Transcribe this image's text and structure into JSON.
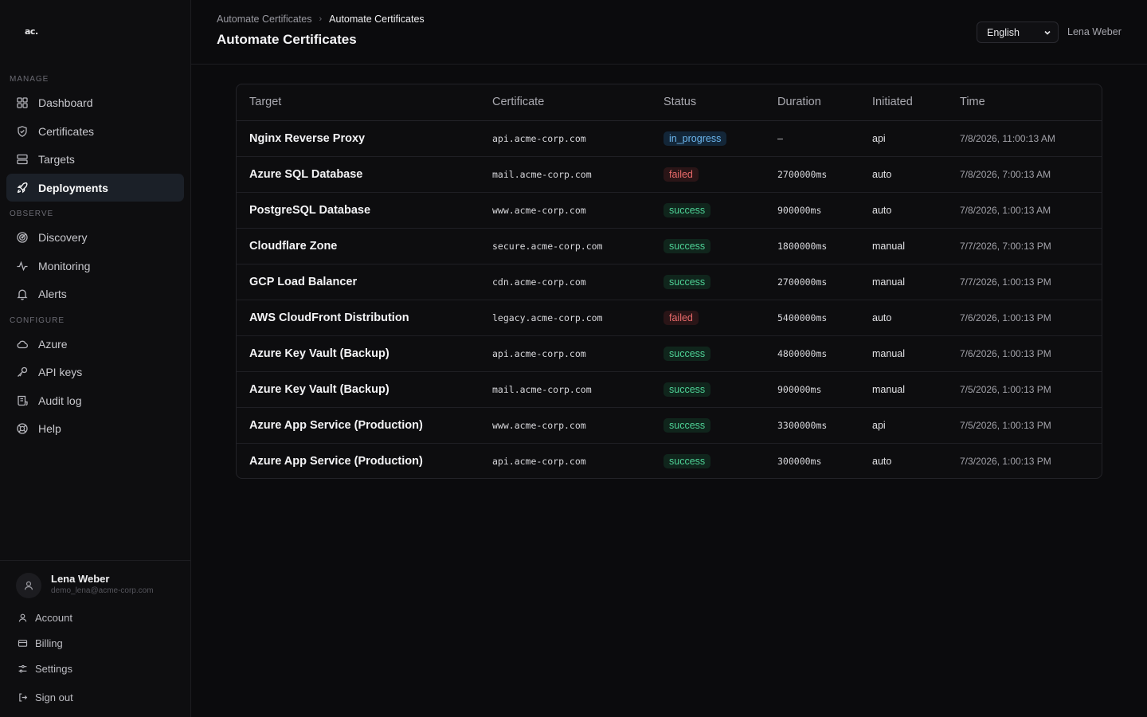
{
  "app": {
    "logo": "ac."
  },
  "sidebar": {
    "sections": {
      "manage": "MANAGE",
      "observe": "OBSERVE",
      "configure": "CONFIGURE"
    },
    "items": [
      {
        "label": "Dashboard",
        "icon": "grid-icon"
      },
      {
        "label": "Certificates",
        "icon": "shield-check-icon"
      },
      {
        "label": "Targets",
        "icon": "server-icon"
      },
      {
        "label": "Deployments",
        "icon": "rocket-icon",
        "active": true
      },
      {
        "label": "Discovery",
        "icon": "radar-icon"
      },
      {
        "label": "Monitoring",
        "icon": "activity-icon"
      },
      {
        "label": "Alerts",
        "icon": "bell-icon"
      },
      {
        "label": "Azure",
        "icon": "cloud-icon"
      },
      {
        "label": "API keys",
        "icon": "key-icon"
      },
      {
        "label": "Audit log",
        "icon": "scroll-icon"
      },
      {
        "label": "Help",
        "icon": "lifebuoy-icon"
      }
    ],
    "user": {
      "name": "Lena Weber",
      "email": "demo_lena@acme-corp.com",
      "links": {
        "account": "Account",
        "billing": "Billing",
        "settings": "Settings",
        "signout": "Sign out"
      }
    }
  },
  "header": {
    "breadcrumb": {
      "parent": "Automate Certificates",
      "current": "Automate Certificates"
    },
    "title": "Automate Certificates",
    "language": "English",
    "user_name": "Lena Weber"
  },
  "table": {
    "columns": [
      "Target",
      "Certificate",
      "Status",
      "Duration",
      "Initiated",
      "Time"
    ],
    "rows": [
      {
        "target": "Nginx Reverse Proxy",
        "certificate": "api.acme-corp.com",
        "status": "in_progress",
        "duration": "—",
        "initiated": "api",
        "time": "7/8/2026, 11:00:13 AM"
      },
      {
        "target": "Azure SQL Database",
        "certificate": "mail.acme-corp.com",
        "status": "failed",
        "duration": "2700000ms",
        "initiated": "auto",
        "time": "7/8/2026, 7:00:13 AM"
      },
      {
        "target": "PostgreSQL Database",
        "certificate": "www.acme-corp.com",
        "status": "success",
        "duration": "900000ms",
        "initiated": "auto",
        "time": "7/8/2026, 1:00:13 AM"
      },
      {
        "target": "Cloudflare Zone",
        "certificate": "secure.acme-corp.com",
        "status": "success",
        "duration": "1800000ms",
        "initiated": "manual",
        "time": "7/7/2026, 7:00:13 PM"
      },
      {
        "target": "GCP Load Balancer",
        "certificate": "cdn.acme-corp.com",
        "status": "success",
        "duration": "2700000ms",
        "initiated": "manual",
        "time": "7/7/2026, 1:00:13 PM"
      },
      {
        "target": "AWS CloudFront Distribution",
        "certificate": "legacy.acme-corp.com",
        "status": "failed",
        "duration": "5400000ms",
        "initiated": "auto",
        "time": "7/6/2026, 1:00:13 PM"
      },
      {
        "target": "Azure Key Vault (Backup)",
        "certificate": "api.acme-corp.com",
        "status": "success",
        "duration": "4800000ms",
        "initiated": "manual",
        "time": "7/6/2026, 1:00:13 PM"
      },
      {
        "target": "Azure Key Vault (Backup)",
        "certificate": "mail.acme-corp.com",
        "status": "success",
        "duration": "900000ms",
        "initiated": "manual",
        "time": "7/5/2026, 1:00:13 PM"
      },
      {
        "target": "Azure App Service (Production)",
        "certificate": "www.acme-corp.com",
        "status": "success",
        "duration": "3300000ms",
        "initiated": "api",
        "time": "7/5/2026, 1:00:13 PM"
      },
      {
        "target": "Azure App Service (Production)",
        "certificate": "api.acme-corp.com",
        "status": "success",
        "duration": "300000ms",
        "initiated": "auto",
        "time": "7/3/2026, 1:00:13 PM"
      }
    ]
  },
  "colors": {
    "background": "#0b0b0d",
    "active_nav": "#1b2028",
    "status_in_progress": "#6cb6ee",
    "status_failed": "#e86a6a",
    "status_success": "#4ed296"
  }
}
